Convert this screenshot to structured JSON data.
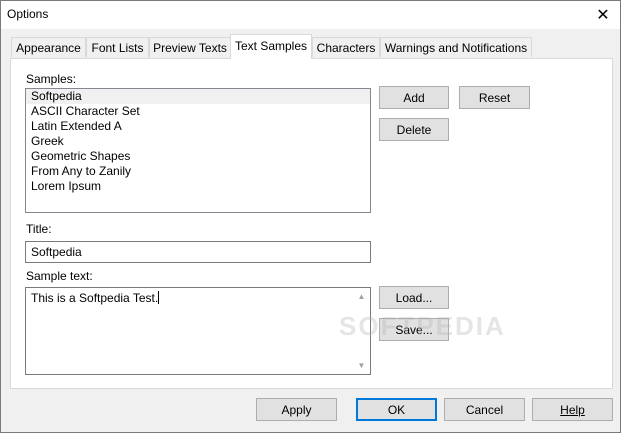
{
  "window": {
    "title": "Options",
    "close_glyph": "✕"
  },
  "tabs": [
    {
      "label": "Appearance"
    },
    {
      "label": "Font Lists"
    },
    {
      "label": "Preview Texts"
    },
    {
      "label": "Text Samples"
    },
    {
      "label": "Characters"
    },
    {
      "label": "Warnings and Notifications"
    }
  ],
  "samples": {
    "label": "Samples:",
    "items": [
      "Softpedia",
      "ASCII Character Set",
      "Latin Extended A",
      "Greek",
      "Geometric Shapes",
      "From Any to Zanily",
      "Lorem Ipsum"
    ],
    "selected": "Softpedia"
  },
  "buttons": {
    "add": "Add",
    "reset": "Reset",
    "delete": "Delete",
    "load": "Load...",
    "save": "Save...",
    "apply": "Apply",
    "ok": "OK",
    "cancel": "Cancel",
    "help": "Help"
  },
  "title_field": {
    "label": "Title:",
    "value": "Softpedia"
  },
  "sample_text": {
    "label": "Sample text:",
    "value": "This is a Softpedia Test."
  },
  "watermark": "SOFTPEDIA",
  "icons": {
    "close": "close-icon",
    "scroll_up": "scroll-up-icon",
    "scroll_down": "scroll-down-icon"
  }
}
